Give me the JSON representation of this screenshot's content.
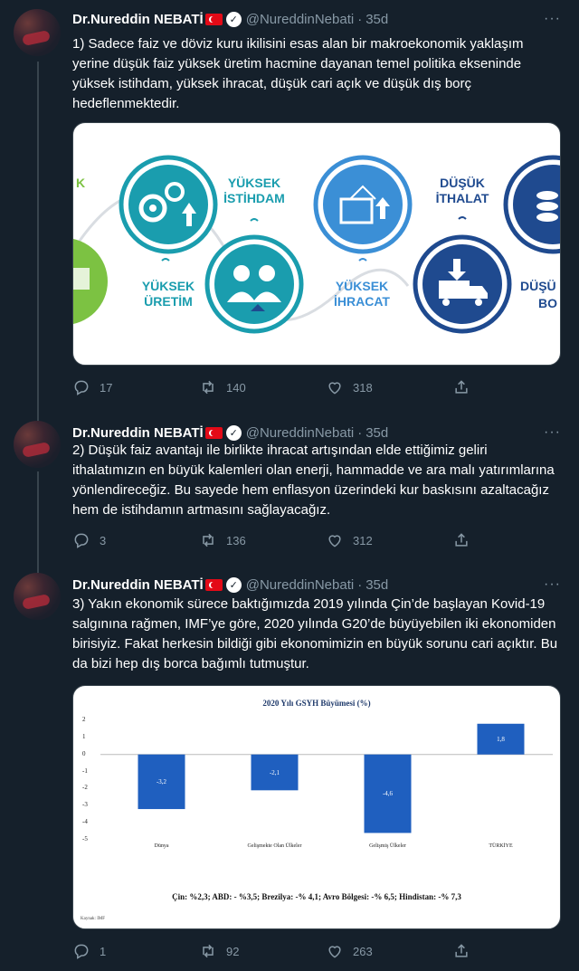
{
  "author": {
    "name": "Dr.Nureddin NEBATİ",
    "handle": "@NureddinNebati",
    "verified_glyph": "✓"
  },
  "separator": "·",
  "more_glyph": "···",
  "tweets": [
    {
      "time": "35d",
      "text": "1) Sadece faiz ve döviz kuru ikilisini esas alan bir makroekonomik yaklaşım yerine düşük faiz yüksek üretim hacmine dayanan temel politika ekseninde yüksek istihdam, yüksek ihracat, düşük cari açık ve düşük dış borç hedeflenmektedir.",
      "replies": "17",
      "retweets": "140",
      "likes": "318"
    },
    {
      "time": "35d",
      "text": "2) Düşük faiz avantajı ile birlikte ihracat artışından elde ettiğimiz geliri ithalatımızın en büyük kalemleri olan enerji, hammadde ve ara malı yatırımlarına yönlendireceğiz. Bu sayede hem enflasyon üzerindeki kur baskısını azaltacağız hem de istihdamın artmasını sağlayacağız.",
      "replies": "3",
      "retweets": "136",
      "likes": "312"
    },
    {
      "time": "35d",
      "text": "3) Yakın ekonomik sürece baktığımızda 2019 yılında Çin’de başlayan Kovid-19 salgınına rağmen, IMF’ye  göre, 2020 yılında G20’de büyüyebilen iki ekonomiden birisiyiz. Fakat herkesin bildiği gibi ekonomimizin en büyük sorunu cari açıktır. Bu da bizi hep dış borca bağımlı tutmuştur.",
      "replies": "1",
      "retweets": "92",
      "likes": "263"
    }
  ],
  "infographic": {
    "labels": {
      "k": "K",
      "yuksek_istihdam": "YÜKSEK\nİSTİHDAM",
      "dusuk_ithalat": "DÜŞÜK\nİTHALAT",
      "yuksek_uretim": "YÜKSEK\nÜRETİM",
      "yuksek_ihracat": "YÜKSEK\nİHRACAT",
      "dusu": "DÜŞÜ",
      "bo": "BO"
    },
    "colors": {
      "teal": "#1a9dae",
      "blue": "#1f4a8f",
      "green": "#7cc242",
      "light_blue": "#3b8fd6"
    }
  },
  "chart_data": {
    "type": "bar",
    "title": "2020 Yılı GSYH Büyümesi (%)",
    "categories": [
      "Dünya",
      "Gelişmekte Olan Ülkeler",
      "Gelişmiş Ülkeler",
      "TÜRKİYE"
    ],
    "values": [
      -3.2,
      -2.1,
      -4.6,
      1.8
    ],
    "value_labels": [
      "-3,2",
      "-2,1",
      "-4,6",
      "1,8"
    ],
    "ylim": [
      -5,
      2
    ],
    "yticks": [
      "2",
      "1",
      "0",
      "-1",
      "-2",
      "-3",
      "-4",
      "-5"
    ],
    "bar_color": "#1f5fbf",
    "footnote": "Çin: %2,3; ABD: - %3,5; Brezilya: -% 4,1; Avro Bölgesi: -% 6,5; Hindistan: -% 7,3",
    "source": "Kaynak: IMF",
    "grid": false,
    "legend": "none"
  }
}
